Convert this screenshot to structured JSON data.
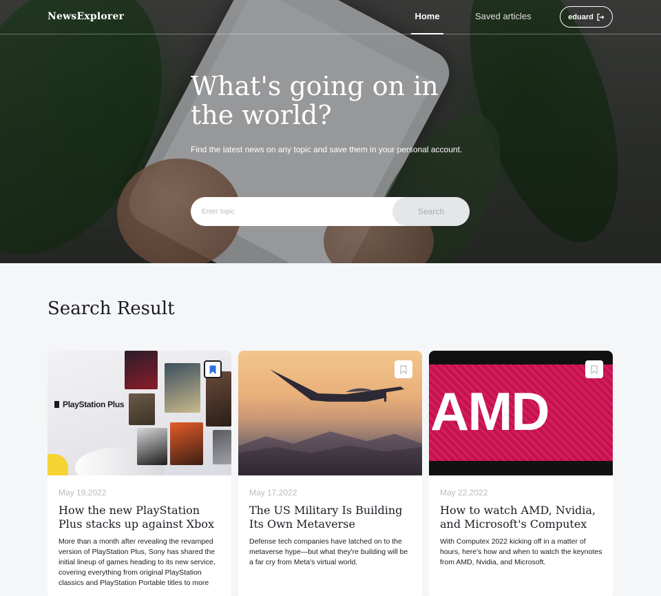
{
  "header": {
    "logo": "NewsExplorer",
    "nav": {
      "home": "Home",
      "saved": "Saved articles"
    },
    "user": {
      "name": "eduard",
      "icon": "logout-icon"
    }
  },
  "hero": {
    "title": "What's going on in the world?",
    "subtitle": "Find the latest news on any topic and save them in your personal account.",
    "search": {
      "placeholder": "Enter topic",
      "button": "Search"
    }
  },
  "results": {
    "title": "Search Result",
    "cards": [
      {
        "date": "May 19,2022",
        "title": "How the new PlayStation Plus stacks up against Xbox Game Pass",
        "text": "More than a month after revealing the revamped version of PlayStation Plus, Sony has shared the initial lineup of games heading to its new service, covering everything from original PlayStation classics and PlayStation Portable titles to more recent hits.",
        "image_label": "PlayStation Plus",
        "bookmarked": true
      },
      {
        "date": "May 17,2022",
        "title": "The US Military Is Building Its Own Metaverse",
        "text": "Defense tech companies have latched on to the metaverse hype—but what they're building will be a far cry from Meta's virtual world.",
        "bookmarked": false
      },
      {
        "date": "May 22,2022",
        "title": "How to watch AMD, Nvidia, and Microsoft's Computex keynotes",
        "text": "With Computex 2022 kicking off in a matter of hours, here's how and when to watch the keynotes from AMD, Nvidia, and Microsoft.",
        "image_label": "AMD",
        "bookmarked": false
      }
    ]
  },
  "colors": {
    "accent": "#2f71e5",
    "text": "#1a1b22",
    "muted": "#b6bcbf"
  }
}
